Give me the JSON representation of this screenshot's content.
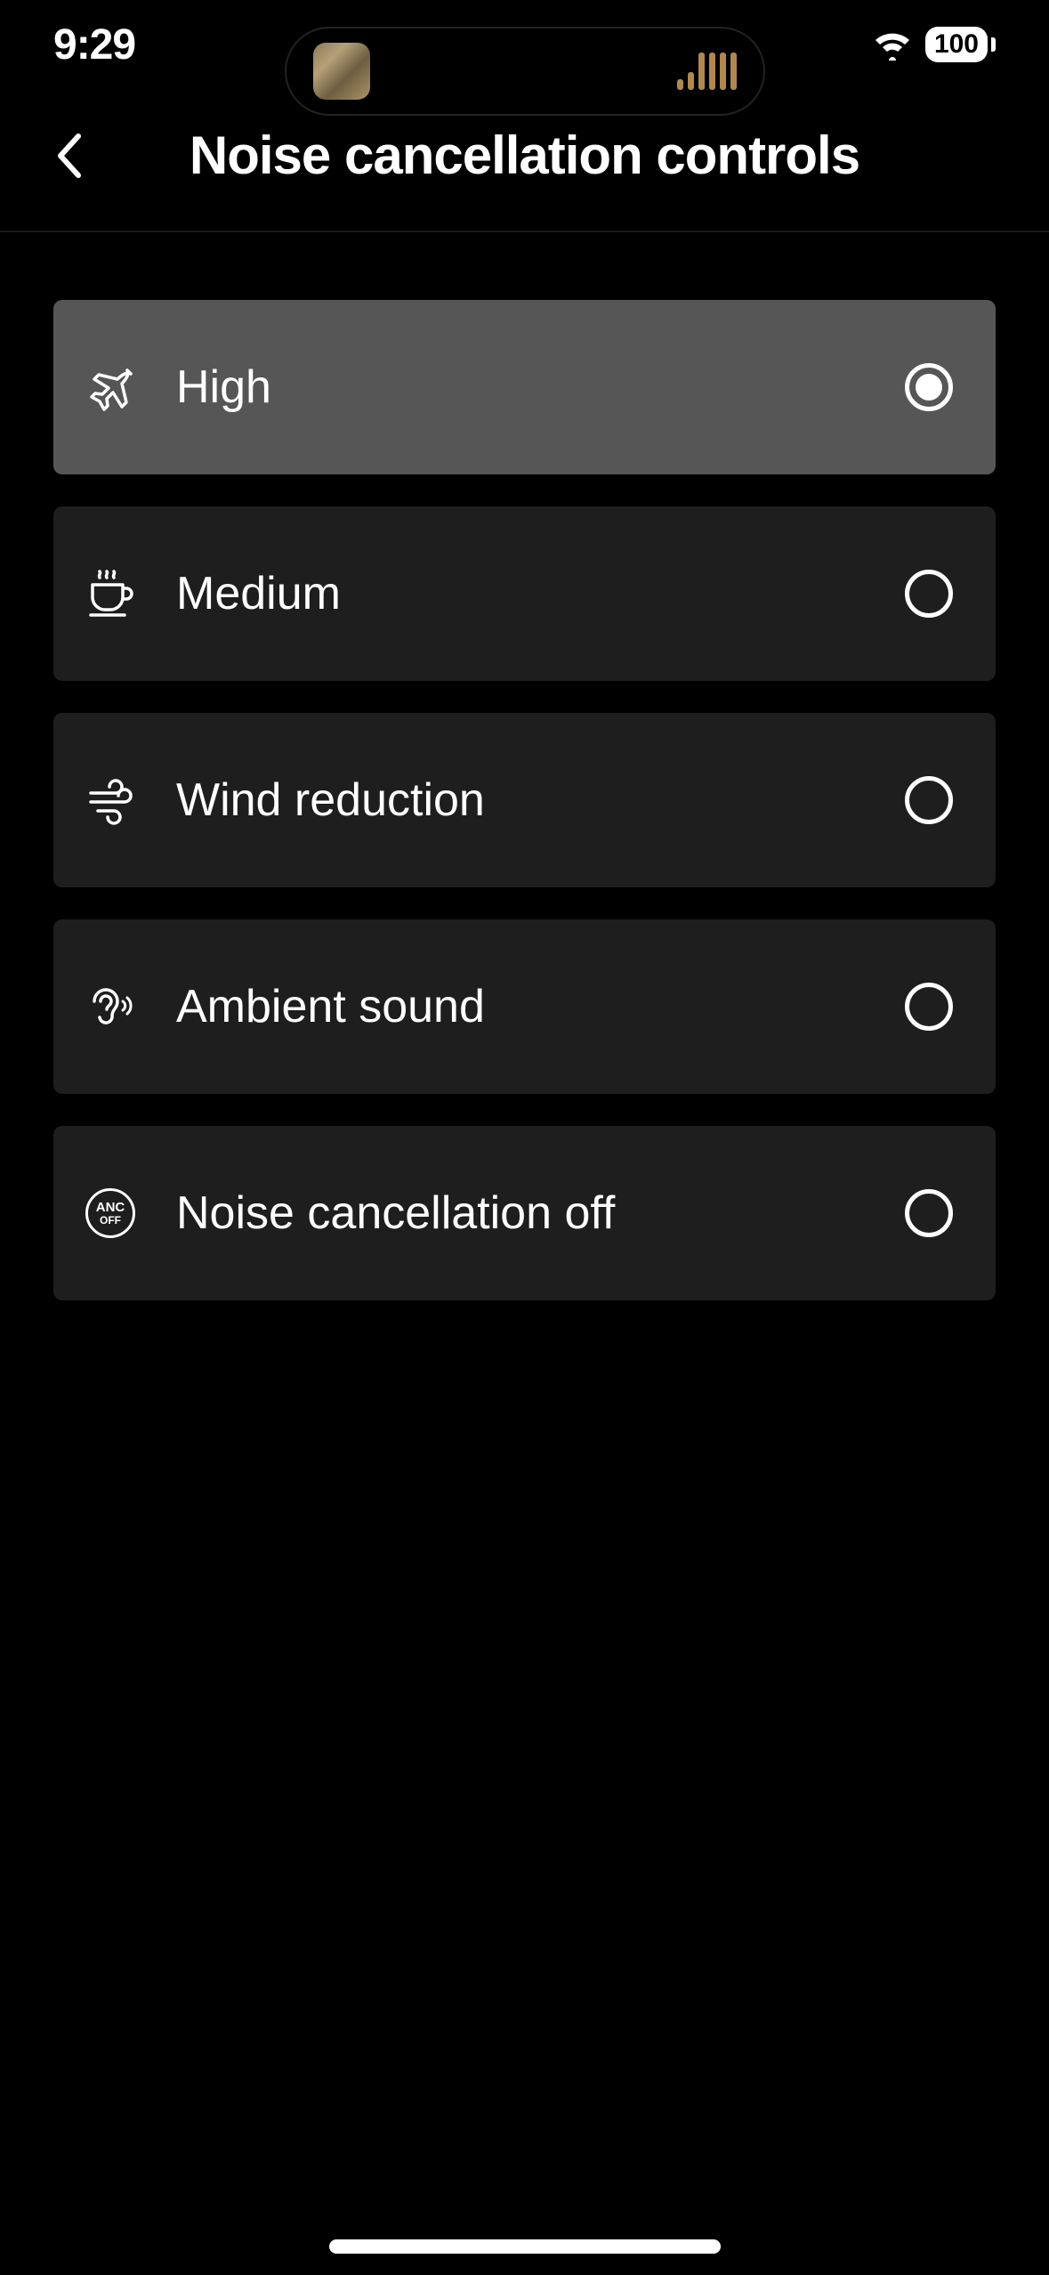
{
  "status": {
    "time": "9:29",
    "battery": "100"
  },
  "header": {
    "title": "Noise cancellation controls"
  },
  "options": [
    {
      "id": "high",
      "label": "High",
      "icon": "airplane-icon",
      "selected": true
    },
    {
      "id": "medium",
      "label": "Medium",
      "icon": "coffee-icon",
      "selected": false
    },
    {
      "id": "wind",
      "label": "Wind reduction",
      "icon": "wind-icon",
      "selected": false
    },
    {
      "id": "ambient",
      "label": "Ambient sound",
      "icon": "ear-icon",
      "selected": false
    },
    {
      "id": "off",
      "label": "Noise cancellation off",
      "icon": "anc-off-icon",
      "selected": false
    }
  ],
  "anc_badge": {
    "line1": "ANC",
    "line2": "OFF"
  }
}
